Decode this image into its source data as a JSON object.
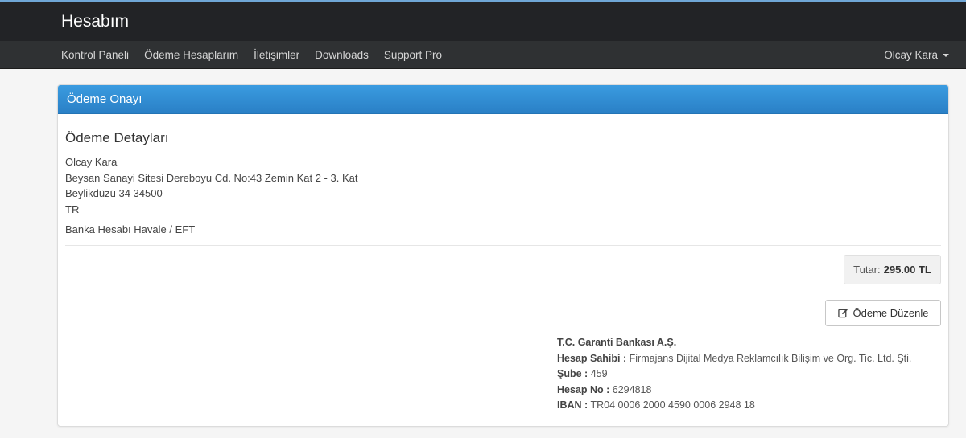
{
  "brand": "Hesabım",
  "nav": {
    "links": [
      "Kontrol Paneli",
      "Ödeme Hesaplarım",
      "İletişimler",
      "Downloads",
      "Support Pro"
    ],
    "user": "Olcay Kara"
  },
  "panel": {
    "title": "Ödeme Onayı",
    "details_title": "Ödeme Detayları",
    "address": [
      "Olcay Kara",
      "Beysan Sanayi Sitesi Dereboyu Cd. No:43 Zemin Kat 2 - 3. Kat",
      "Beylikdüzü 34 34500",
      "TR"
    ],
    "method": "Banka Hesabı Havale / EFT",
    "total_label": "Tutar:",
    "total_value": "295.00 TL",
    "edit_label": "Ödeme Düzenle",
    "edit_icon": "edit-icon",
    "bank": {
      "name": "T.C. Garanti Bankası A.Ş.",
      "holder_label": "Hesap Sahibi :",
      "holder_value": "Firmajans Dijital Medya Reklamcılık Bilişim ve Org. Tic. Ltd. Şti.",
      "branch_label": "Şube :",
      "branch_value": "459",
      "account_label": "Hesap No :",
      "account_value": "6294818",
      "iban_label": "IBAN :",
      "iban_value": "TR04 0006 2000 4590 0006 2948 18"
    }
  },
  "colors": {
    "accent": "#2a80c6",
    "navbar": "#222326"
  }
}
